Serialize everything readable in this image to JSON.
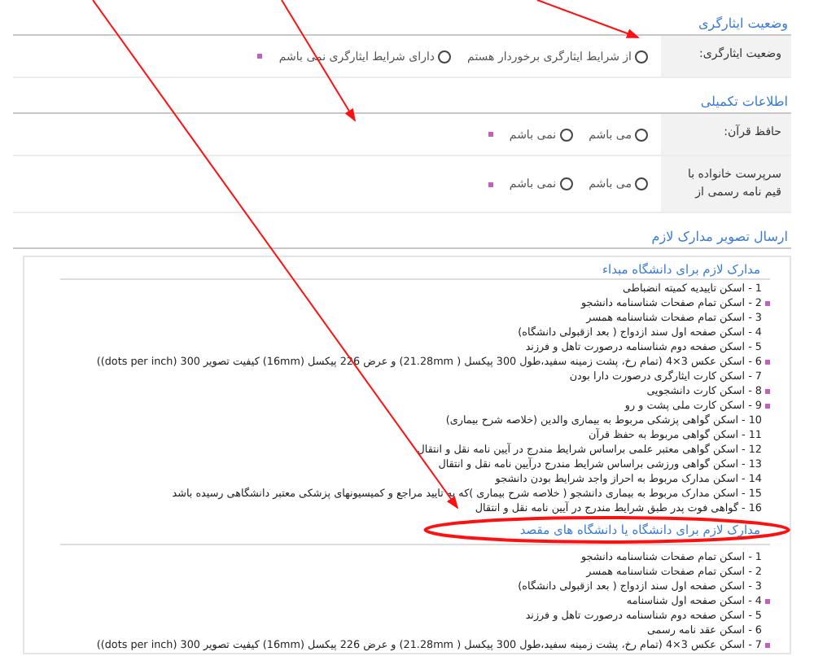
{
  "sections": [
    {
      "title": "وضعیت ایثارگری",
      "rows": [
        {
          "label": "وضعیت ایثارگری:",
          "required": true,
          "options": [
            {
              "label": "از شرایط ایثارگری برخوردار هستم",
              "selected": false
            },
            {
              "label": "دارای شرایط ایثارگری نمی باشم",
              "selected": false
            }
          ]
        }
      ]
    },
    {
      "title": "اطلاعات تکمیلی",
      "rows": [
        {
          "label": "حافظ قرآن:",
          "required": true,
          "options": [
            {
              "label": "می باشم",
              "selected": false
            },
            {
              "label": "نمی باشم",
              "selected": false
            }
          ]
        },
        {
          "label": "سرپرست خانواده با قیم نامه رسمی از",
          "required": true,
          "options": [
            {
              "label": "می باشم",
              "selected": false
            },
            {
              "label": "نمی باشم",
              "selected": false
            }
          ]
        }
      ]
    }
  ],
  "documents": {
    "title": "ارسال تصویر مدارک لازم",
    "groups": [
      {
        "title": "مدارک لازم برای دانشگاه مبداء",
        "items": [
          {
            "text": "1 - اسکن تاییدیه کمیته انضباطی",
            "required": false
          },
          {
            "text": "2 - اسکن تمام صفحات شناسنامه دانشجو",
            "required": true
          },
          {
            "text": "3 - اسکن تمام صفحات شناسنامه همسر",
            "required": false
          },
          {
            "text": "4 - اسکن صفحه اول سند ازدواج ( بعد ازقبولی دانشگاه)",
            "required": false
          },
          {
            "text": "5 - اسکن صفحه دوم شناسنامه درصورت تاهل و فرزند",
            "required": false
          },
          {
            "text": "6 - اسکن عکس 3×4 (تمام رخ، پشت زمینه سفید،طول 300 پیکسل ( 21.28mm) و عرض 226 پیکسل (16mm) کیفیت تصویر 300 (dots per inch))",
            "required": true
          },
          {
            "text": "7 - اسکن کارت ایثارگری درصورت دارا بودن",
            "required": false
          },
          {
            "text": "8 - اسکن کارت دانشجویی",
            "required": true
          },
          {
            "text": "9 - اسکن کارت ملی پشت و رو",
            "required": true
          },
          {
            "text": "10 - اسکن گواهی پزشکی مربوط به بیماری والدین (خلاصه شرح بیماری)",
            "required": false
          },
          {
            "text": "11 - اسکن گواهی مربوط به حفظ قرآن",
            "required": false
          },
          {
            "text": "12 - اسکن گواهی معتبر علمی براساس شرایط مندرج در آیین نامه نقل و انتقال",
            "required": false
          },
          {
            "text": "13 - اسکن گواهی ورزشی براساس شرایط مندرج درآیین نامه نقل و انتقال",
            "required": false
          },
          {
            "text": "14 - اسکن مدارک مربوط به احراز واجد شرایط بودن دانشجو",
            "required": false
          },
          {
            "text": "15 - اسکن مدارک مربوط به بیماری دانشجو ( خلاصه شرح بیماری )که به تایید مراجع و کمیسیونهای پزشکی معتبر دانشگاهی رسیده باشد",
            "required": false
          },
          {
            "text": "16 - گواهی فوت پدر طبق شرایط مندرج در آیین نامه نقل و انتقال",
            "required": false
          }
        ]
      },
      {
        "title": "مدارک لازم برای دانشگاه یا دانشگاه های مقصد",
        "circled": true,
        "items": [
          {
            "text": "1 - اسکن تمام صفحات شناسنامه دانشجو",
            "required": false
          },
          {
            "text": "2 - اسکن تمام صفحات شناسنامه همسر",
            "required": false
          },
          {
            "text": "3 - اسکن صفحه اول سند ازدواج ( بعد ازقبولی دانشگاه)",
            "required": false
          },
          {
            "text": "4 - اسکن صفحه اول شناسنامه",
            "required": true
          },
          {
            "text": "5 - اسکن صفحه دوم شناسنامه درصورت تاهل و فرزند",
            "required": false
          },
          {
            "text": "6 - اسکن عقد نامه رسمی",
            "required": false
          },
          {
            "text": "7 - اسکن عکس 3×4 (تمام رخ، پشت زمینه سفید،طول 300 پیکسل ( 21.28mm) و عرض 226 پیکسل (16mm) کیفیت تصویر 300 (dots per inch))",
            "required": true
          }
        ]
      }
    ]
  }
}
